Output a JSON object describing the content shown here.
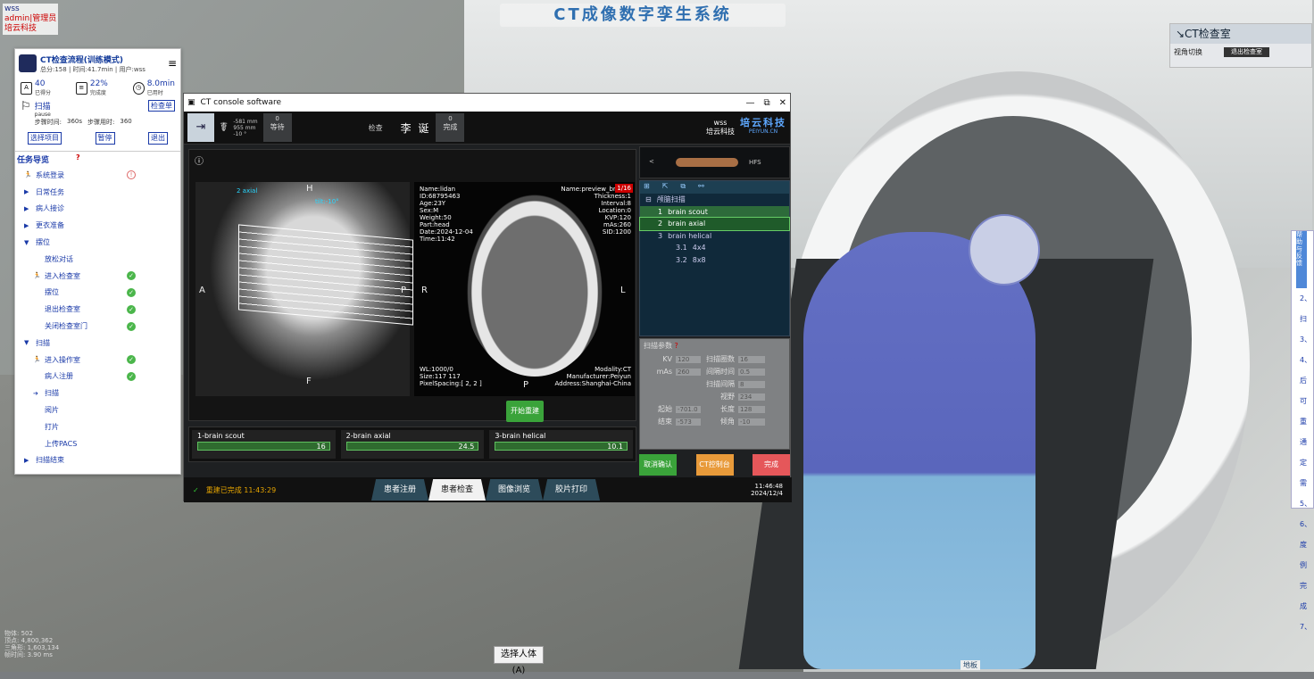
{
  "top_banner": "CT成像数字孪生系统",
  "top_left_tag": [
    "wss",
    "admin|管理员",
    "培云科技"
  ],
  "right_panel": {
    "title": "↘CT检查室",
    "view_label": "视角切换",
    "exit_btn": "退出检查室"
  },
  "help_items": [
    "2、",
    "扫",
    "3、",
    "4、",
    "后可",
    "重通",
    "定需",
    "5、",
    "6、",
    "度例",
    "完成",
    "7、"
  ],
  "help_head": "帮助与反馈",
  "left_panel": {
    "title": "CT检查流程(训练模式)",
    "subtitle": "总分:158 | 时间:41.7min | 用户:wss",
    "stats": [
      {
        "v": "40",
        "l": "已得分"
      },
      {
        "v": "22%",
        "l": "完成度"
      },
      {
        "v": "8.0min",
        "l": "已用时"
      }
    ],
    "scan_name": "扫描",
    "scan_state": "pause",
    "step_time_label": "步骤时间:",
    "step_time": "360s",
    "step_used_label": "步骤用时:",
    "step_used": "360",
    "check_btn": "检查单",
    "btn_select": "选择项目",
    "btn_pause": "暂停",
    "btn_exit": "退出",
    "nav_title": "任务导览",
    "nav_q": "?",
    "nav": [
      {
        "label": "系统登录",
        "arrow": "🏃",
        "state": "warn"
      },
      {
        "label": "日常任务",
        "arrow": "▶",
        "state": ""
      },
      {
        "label": "病人接诊",
        "arrow": "▶",
        "state": ""
      },
      {
        "label": "更衣准备",
        "arrow": "▶",
        "state": ""
      },
      {
        "label": "摆位",
        "arrow": "▼",
        "state": ""
      },
      {
        "label": "放松对话",
        "arrow": "",
        "state": ""
      },
      {
        "label": "进入检查室",
        "arrow": "🏃",
        "state": "ok"
      },
      {
        "label": "摆位",
        "arrow": "",
        "state": "ok"
      },
      {
        "label": "退出检查室",
        "arrow": "",
        "state": "ok"
      },
      {
        "label": "关闭检查室门",
        "arrow": "",
        "state": "ok"
      },
      {
        "label": "扫描",
        "arrow": "▼",
        "state": ""
      },
      {
        "label": "进入操作室",
        "arrow": "🏃",
        "state": "ok"
      },
      {
        "label": "病人注册",
        "arrow": "",
        "state": "ok"
      },
      {
        "label": "扫描",
        "arrow": "➔",
        "state": ""
      },
      {
        "label": "阅片",
        "arrow": "",
        "state": ""
      },
      {
        "label": "打片",
        "arrow": "",
        "state": ""
      },
      {
        "label": "上传PACS",
        "arrow": "",
        "state": ""
      },
      {
        "label": "扫描结束",
        "arrow": "▶",
        "state": ""
      }
    ]
  },
  "ct": {
    "window_title": "CT console software",
    "waiting_count": "0",
    "waiting_label": "等待",
    "done_count": "0",
    "done_label": "完成",
    "exam_label": "检查",
    "patient_name": "李 诞",
    "mini": [
      "-581 mm",
      "955 mm",
      "-10 °"
    ],
    "brand_user": "wss",
    "brand_company": "培云科技",
    "brand_logo": "培云科技",
    "brand_url": "PEIYUN.CN",
    "scout_series": "2 axial",
    "tilt": "tilt:-10°",
    "dirs": {
      "H": "H",
      "F": "F",
      "A": "A",
      "P": "P",
      "R": "R",
      "L": "L",
      "Pb": "P"
    },
    "axial_info_left": [
      "Name:lidan",
      "ID:68795463",
      "Age:23Y",
      "Sex:M",
      "Weight:50",
      "Part:head",
      "Date:2024-12-04",
      "Time:11:42"
    ],
    "axial_info_right": [
      "Name:preview_brain a",
      "Thickness:1",
      "Interval:8",
      "Location:0",
      "KVP:120",
      "mAs:260",
      "SID:1200"
    ],
    "axial_info_bl": [
      "WL:1000/0",
      "Size:117 117",
      "PixelSpacing:[ 2, 2 ]"
    ],
    "axial_info_br": [
      "Modality:CT",
      "Manufacturer:Peiyun",
      "Address:Shanghai-China"
    ],
    "page_badge": "1/16",
    "start_btn": "开始重建",
    "progress": [
      {
        "name": "1-brain scout",
        "value": "16",
        "pct": 1.0
      },
      {
        "name": "2-brain axial",
        "value": "24.5",
        "pct": 1.0
      },
      {
        "name": "3-brain helical",
        "value": "10.1",
        "pct": 1.0
      }
    ],
    "hfs": "HFS",
    "tree_title": "颅脑扫描",
    "tree": [
      {
        "n": "1",
        "l": "brain scout",
        "c": "hi"
      },
      {
        "n": "2",
        "l": "brain axial",
        "c": "hi2"
      },
      {
        "n": "3",
        "l": "brain helical",
        "c": ""
      },
      {
        "n": "3.1",
        "l": "4x4",
        "c": ""
      },
      {
        "n": "3.2",
        "l": "8x8",
        "c": ""
      }
    ],
    "params_title": "扫描参数",
    "params": [
      [
        "KV",
        "120",
        "扫描圈数",
        "16"
      ],
      [
        "mAs",
        "260",
        "间隔时间",
        "0.5"
      ],
      [
        "",
        "",
        "扫描间隔",
        "8"
      ],
      [
        "",
        "",
        "视野",
        "234"
      ],
      [
        "起始",
        "-701.0",
        "长度",
        "128"
      ],
      [
        "结束",
        "-573",
        "倾角",
        "-10"
      ]
    ],
    "btn_cancel": "取消确认",
    "btn_ctcontrol": "CT控制台",
    "btn_finish": "完成",
    "status_text": "重建已完成 11:43:29",
    "tabs": [
      "患者注册",
      "患者检查",
      "图像浏览",
      "胶片打印"
    ],
    "time": "11:46:48",
    "date": "2024/12/4"
  },
  "bottom_btn": "选择人体(A)",
  "floor_tag": "地板",
  "stats": [
    "物体: 502",
    "顶点: 4,800,362",
    "三角形: 1,603,134",
    "帧时间: 3.90 ms"
  ]
}
